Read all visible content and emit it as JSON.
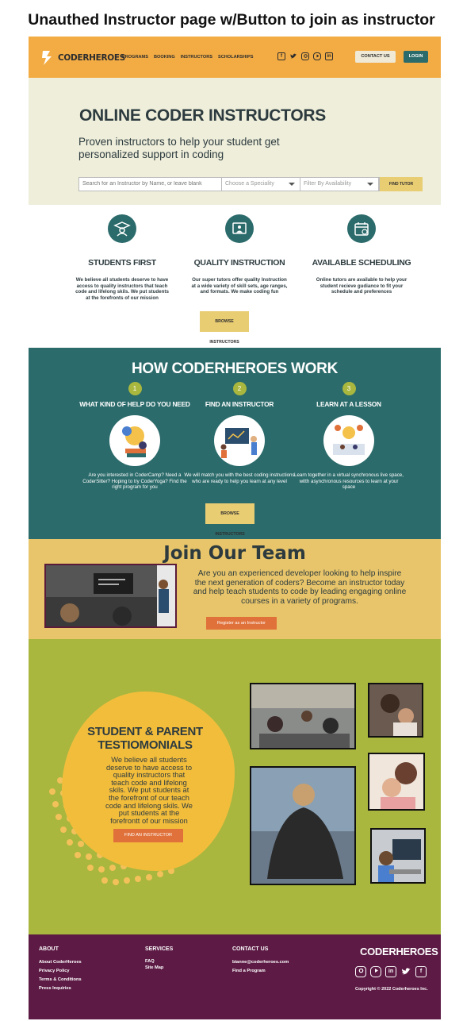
{
  "page_title": "Unauthed Instructor page w/Button to join as instructor",
  "header": {
    "brand": "CODERHEROES",
    "nav": [
      "PROGRAMS",
      "BOOKING",
      "INSTRUCTORS",
      "SCHOLARSHIPS"
    ],
    "social_icons": [
      "facebook-icon",
      "twitter-icon",
      "instagram-icon",
      "youtube-icon",
      "linkedin-icon"
    ],
    "contact_label": "CONTACT US",
    "login_label": "LOGIN"
  },
  "hero": {
    "title": "ONLINE CODER INSTRUCTORS",
    "subtitle": "Proven instructors to help your student get personalized support in coding",
    "search_placeholder": "Search for an Instructor by Name, or leave blank",
    "speciality_select": "Choose a Speciality",
    "availability_select": "Filter By Availability",
    "find_button": "FIND TUTOR"
  },
  "features": [
    {
      "icon": "graduate-icon",
      "title": "STUDENTS FIRST",
      "text": "We believe  all students deserve to have access to quality instructors that teach code and lifelong skils. We put students at the forefronts of our mission"
    },
    {
      "icon": "presentation-icon",
      "title": "QUALITY INSTRUCTION",
      "text": "Our super tutors offer quality Instruction at a wide variety of skill sets, age ranges, and formats. We make coding fun"
    },
    {
      "icon": "calendar-icon",
      "title": "AVAILABLE SCHEDULING",
      "text": "Online tutors are available to help your student recieve gudiance to fit your schedule and preferences"
    }
  ],
  "browse_label": "BROWSE INSTRUCTORS",
  "how": {
    "title": "HOW CODERHEROES WORK",
    "steps": [
      {
        "num": "1",
        "title": "WHAT KIND OF HELP DO YOU NEED",
        "text": "Are you interested in CoderCamp? Need a CoderSitter? Hoping to try CoderYoga? Find the right program for you"
      },
      {
        "num": "2",
        "title": "FIND AN INSTRUCTOR",
        "text": "We will match you with the best coding instructions who are ready to help you learn at any level"
      },
      {
        "num": "3",
        "title": "LEARN AT A LESSON",
        "text": "Learn together in a virtual synchronous live space, witth asynchronous resources to learn at your space"
      }
    ],
    "button": "BROWSE INSTRUCTORS"
  },
  "join": {
    "title": "Join Our Team",
    "text": "Are you an experienced developer looking to help inspire the next generation of coders? Become an instructor today and help teach students to code by leading engaging online courses in a variety of programs.",
    "button": "Register as an Instructor"
  },
  "testimonials": {
    "title": "STUDENT & PARENT TESTIOMONIALS",
    "text": "We believe  all students deserve to have access to quality instructors that teach code and lifelong skils. We put students at the forefront of our teach code and lifelong skils. We put students at the forefrontt of our mission",
    "button": "FIND AN INSTRUCTOR"
  },
  "footer": {
    "about_title": "ABOUT",
    "about_links": [
      "About CoderHeroes",
      "Privacy Policy",
      "Terms & Conditions",
      "Press Inquiries"
    ],
    "services_title": "SERVICES",
    "services_links": [
      "FAQ",
      "Site Map"
    ],
    "contact_title": "CONTACT US",
    "contact_email": "bianne@coderheroes.com",
    "contact_link": "Find a Program",
    "brand": "CODERHEROES",
    "copyright": "Copyright © 2022 Coderheroes Inc."
  },
  "colors": {
    "header": "#f3ac44",
    "hero_bg": "#eeeeda",
    "teal": "#2c6b6b",
    "yellow_button": "#e9cd73",
    "join_bg": "#e8c56a",
    "orange_button": "#e0713a",
    "testimonial_bg": "#a9b73e",
    "footer_bg": "#5c1a44"
  }
}
